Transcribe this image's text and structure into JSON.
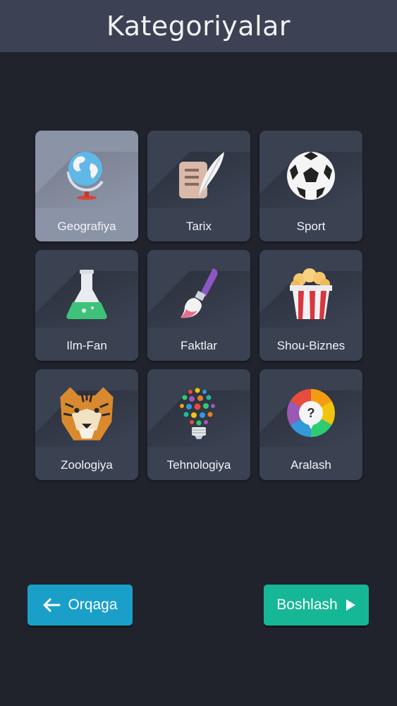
{
  "header": {
    "title": "Kategoriyalar"
  },
  "categories": [
    {
      "label": "Geografiya",
      "icon": "globe-icon",
      "selected": true
    },
    {
      "label": "Tarix",
      "icon": "quill-scroll-icon",
      "selected": false
    },
    {
      "label": "Sport",
      "icon": "soccer-ball-icon",
      "selected": false
    },
    {
      "label": "Ilm-Fan",
      "icon": "flask-icon",
      "selected": false
    },
    {
      "label": "Faktlar",
      "icon": "paintbrush-icon",
      "selected": false
    },
    {
      "label": "Shou-Biznes",
      "icon": "popcorn-icon",
      "selected": false
    },
    {
      "label": "Zoologiya",
      "icon": "tiger-icon",
      "selected": false
    },
    {
      "label": "Tehnologiya",
      "icon": "lightbulb-icon",
      "selected": false
    },
    {
      "label": "Aralash",
      "icon": "question-wheel-icon",
      "selected": false
    }
  ],
  "buttons": {
    "back_label": "Orqaga",
    "start_label": "Boshlash"
  },
  "colors": {
    "background": "#20222c",
    "header": "#3c4253",
    "tile": "#3a4151",
    "tile_selected": "#8b93a6",
    "back_button": "#1aa0c8",
    "start_button": "#16b796"
  }
}
